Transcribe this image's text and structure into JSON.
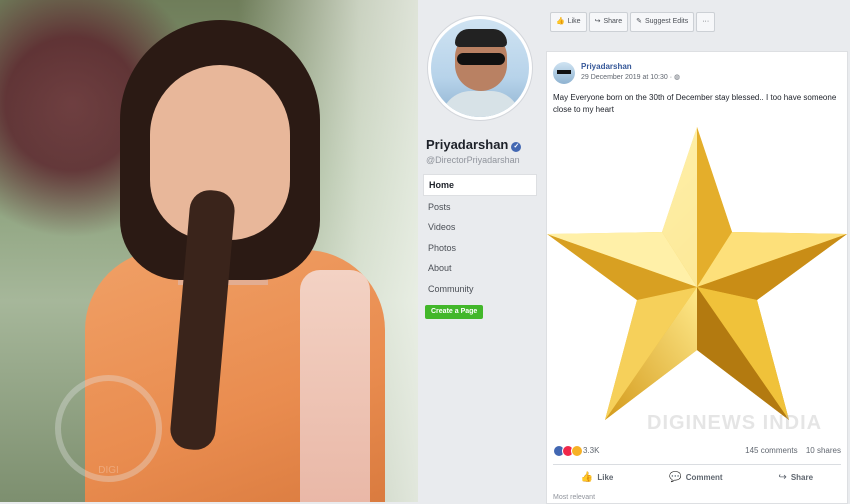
{
  "photo": {
    "watermark_text": "DIGI"
  },
  "page": {
    "name": "Priyadarshan",
    "handle": "@DirectorPriyadarshan",
    "verified_icon": "verified-badge-icon",
    "nav": [
      "Home",
      "Posts",
      "Videos",
      "Photos",
      "About",
      "Community"
    ],
    "active_nav": "Home",
    "create_page_label": "Create a Page"
  },
  "actions": {
    "like": "Like",
    "share": "Share",
    "suggest_edits": "Suggest Edits",
    "more": "···"
  },
  "post": {
    "author": "Priyadarshan",
    "date": "29 December 2019 at 10:30 ·",
    "text": "May Everyone born on the 30th of December stay blessed.. I too have someone close to my heart",
    "watermark": "DIGINEWS INDIA",
    "reaction_count": "3.3K",
    "comments": "145 comments",
    "shares": "10 shares",
    "buttons": {
      "like": "Like",
      "comment": "Comment",
      "share": "Share"
    },
    "most_relevant": "Most relevant"
  },
  "colors": {
    "fb_blue": "#4267b2",
    "link_blue": "#365899",
    "create_green": "#42b72a",
    "background": "#e9ebee"
  }
}
